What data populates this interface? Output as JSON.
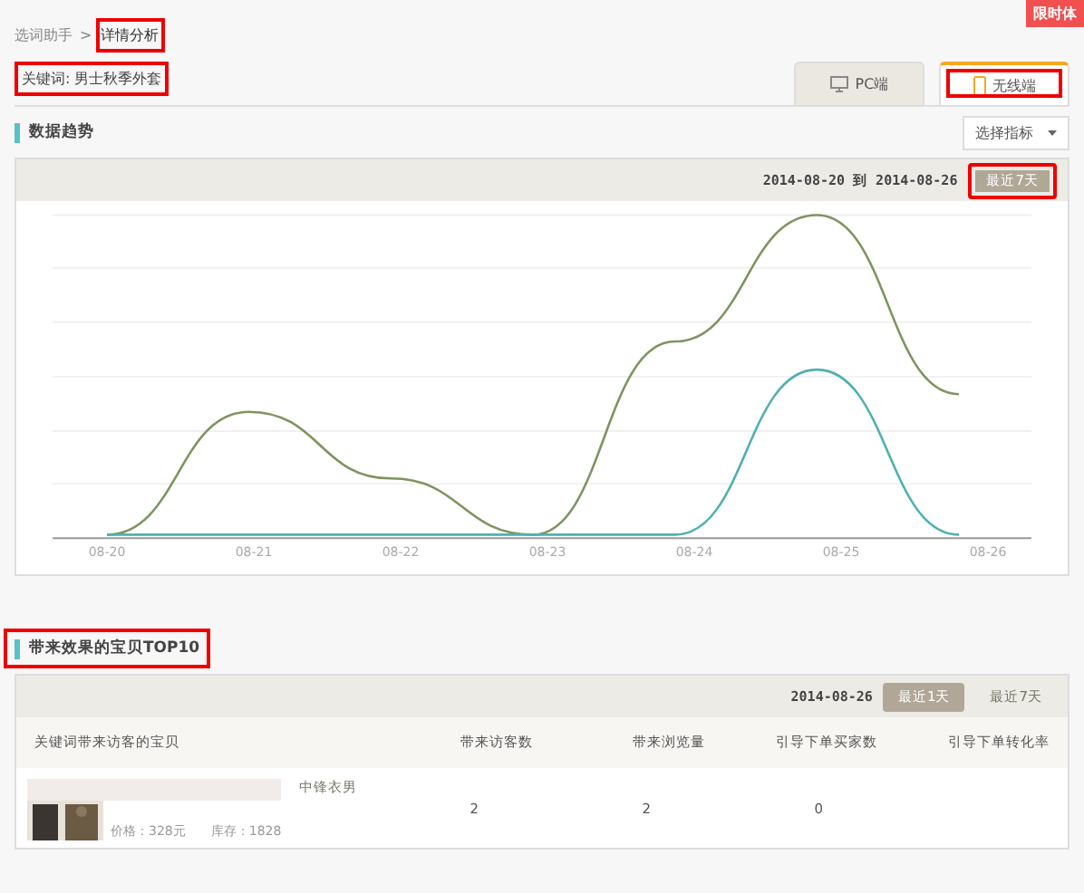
{
  "breadcrumb": {
    "items": [
      "选词助手",
      "详情分析"
    ],
    "separator": ">"
  },
  "badge": "限时体",
  "keyword": "关键词: 男士秋季外套",
  "device_tabs": [
    {
      "label": "PC端",
      "kind": "monitor",
      "selected": false
    },
    {
      "label": "无线端",
      "kind": "phone",
      "selected": true
    }
  ],
  "trend": {
    "title": "数据趋势",
    "select": "选择指标",
    "range": "2014-08-20 到 2014-08-26",
    "range_button": "最近7天",
    "x_labels": [
      "08-20",
      "08-21",
      "08-22",
      "08-23",
      "08-24",
      "08-25",
      "08-26"
    ]
  },
  "top10": {
    "title": "带来效果的宝贝TOP10",
    "date": "2014-08-26",
    "periods": [
      {
        "label": "最近1天",
        "selected": true
      },
      {
        "label": "最近7天",
        "selected": false
      }
    ],
    "columns": [
      "关键词带来访客的宝贝",
      "带来访客数",
      "带来浏览量",
      "引导下单买家数",
      "引导下单转化率"
    ],
    "rows": [
      {
        "title": "中锋衣男",
        "price": "价格：328元",
        "stock": "库存：1828",
        "values": [
          "2",
          "2",
          "0"
        ]
      }
    ]
  }
}
